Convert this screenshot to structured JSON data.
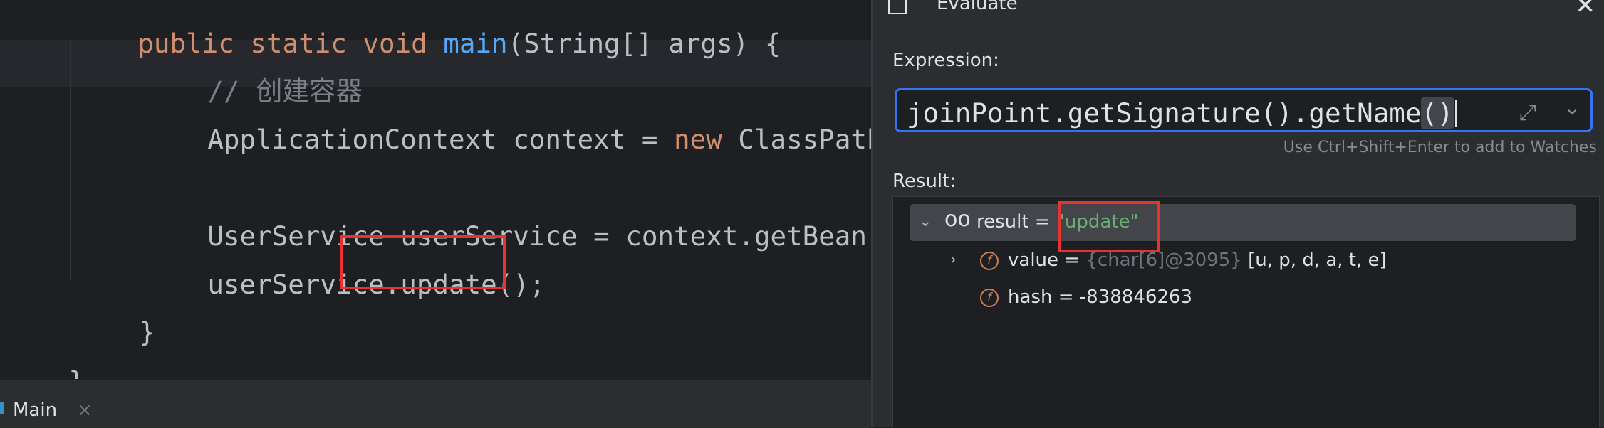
{
  "editor": {
    "lines": {
      "line1": {
        "kw": "public static void ",
        "method": "main",
        "rest": "(String[] args) {"
      },
      "line2": {
        "comment": "// 创建容器"
      },
      "line3": {
        "pre": "ApplicationContext context = ",
        "kw": "new",
        "post": " ClassPathX"
      },
      "line5": {
        "text": "UserService userService = context.getBean(U"
      },
      "line6": {
        "pre": "userService.",
        "call": "update();"
      },
      "line7": {
        "text": "}"
      },
      "line8": {
        "text": "}"
      }
    },
    "tab": {
      "label": "Main",
      "close": "×"
    }
  },
  "dialog": {
    "title": "Evaluate",
    "close": "✕",
    "expression_label": "Expression:",
    "expression_pre": "joinPoint.getSignature().getName",
    "expression_parens": "()",
    "hint": "Use Ctrl+Shift+Enter to add to Watches",
    "result_label": "Result:",
    "result": {
      "root": {
        "name": "result",
        "eq": " = ",
        "value": "\"update\""
      },
      "children": [
        {
          "name": "value",
          "eq": " = ",
          "type": "{char[6]@3095}",
          "value": " [u, p, d, a, t, e]"
        },
        {
          "name": "hash",
          "eq": " = ",
          "value": "-838846263"
        }
      ]
    }
  },
  "icons": {
    "dialog": "evaluate-icon",
    "close": "close-icon",
    "expand": "expand-icon",
    "dropdown": "chevron-down-icon",
    "watch": "glasses-icon",
    "field": "field-icon"
  },
  "colors": {
    "highlight_border": "#e8322d",
    "focus_border": "#3574f0",
    "string": "#6aab73",
    "keyword": "#cf8e6d",
    "method": "#56a8f5"
  }
}
